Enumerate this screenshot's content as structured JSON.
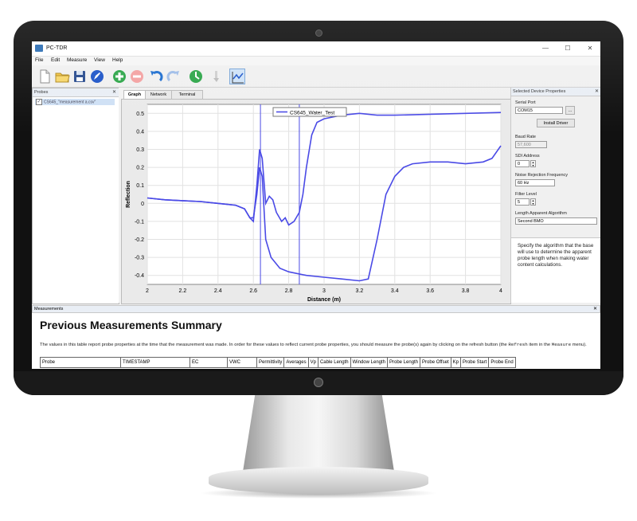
{
  "window": {
    "title": "PC-TDR",
    "minimize": "—",
    "maximize": "☐",
    "close": "✕"
  },
  "menu": [
    "File",
    "Edit",
    "Measure",
    "View",
    "Help"
  ],
  "toolbar_icons": [
    "new-file-icon",
    "open-folder-icon",
    "save-disk-icon",
    "edit-pen-icon",
    "add-icon",
    "remove-icon",
    "undo-icon",
    "redo-icon",
    "measure-icon",
    "pointer-icon",
    "graph-icon"
  ],
  "probes_panel": {
    "title": "Probes",
    "close": "✕",
    "items": [
      {
        "label": "CS645_\"measurement a.csv\"",
        "checked": "✓"
      }
    ]
  },
  "tabs": [
    "Graph",
    "Network",
    "Terminal"
  ],
  "chart_data": {
    "type": "line",
    "title": "",
    "xlabel": "Distance (m)",
    "ylabel": "Reflection",
    "xlim": [
      2,
      4
    ],
    "ylim": [
      -0.45,
      0.55
    ],
    "x_ticks": [
      "2",
      "2.2",
      "2.4",
      "2.6",
      "2.8",
      "3",
      "3.2",
      "3.4",
      "3.6",
      "3.8",
      "4"
    ],
    "y_ticks": [
      "0.5",
      "0.4",
      "0.3",
      "0.2",
      "0.1",
      "0",
      "-0.1",
      "-0.2",
      "-0.3",
      "-0.4"
    ],
    "grid": true,
    "legend": {
      "position": "top-center",
      "entries": [
        "CS645_Water_Test"
      ]
    },
    "vertical_markers": [
      2.64,
      2.86
    ],
    "line_color": "#4a4ae6",
    "series": [
      {
        "name": "CS645_Water_Test",
        "points": [
          [
            2.0,
            0.03
          ],
          [
            2.1,
            0.02
          ],
          [
            2.2,
            0.015
          ],
          [
            2.3,
            0.01
          ],
          [
            2.4,
            0.0
          ],
          [
            2.5,
            -0.01
          ],
          [
            2.55,
            -0.03
          ],
          [
            2.58,
            -0.08
          ],
          [
            2.6,
            -0.1
          ],
          [
            2.62,
            0.1
          ],
          [
            2.635,
            0.3
          ],
          [
            2.65,
            0.25
          ],
          [
            2.67,
            0.0
          ],
          [
            2.69,
            0.04
          ],
          [
            2.71,
            0.02
          ],
          [
            2.73,
            -0.05
          ],
          [
            2.76,
            -0.1
          ],
          [
            2.78,
            -0.08
          ],
          [
            2.8,
            -0.12
          ],
          [
            2.83,
            -0.1
          ],
          [
            2.86,
            -0.05
          ],
          [
            2.88,
            0.05
          ],
          [
            2.9,
            0.2
          ],
          [
            2.93,
            0.38
          ],
          [
            2.96,
            0.45
          ],
          [
            3.0,
            0.47
          ],
          [
            3.1,
            0.49
          ],
          [
            3.2,
            0.5
          ],
          [
            3.3,
            0.49
          ],
          [
            3.4,
            0.49
          ],
          [
            3.6,
            0.495
          ],
          [
            3.8,
            0.5
          ],
          [
            4.0,
            0.505
          ]
        ]
      },
      {
        "name": "",
        "points": [
          [
            2.0,
            0.03
          ],
          [
            2.1,
            0.02
          ],
          [
            2.2,
            0.015
          ],
          [
            2.3,
            0.01
          ],
          [
            2.4,
            0.0
          ],
          [
            2.5,
            -0.01
          ],
          [
            2.55,
            -0.03
          ],
          [
            2.58,
            -0.08
          ],
          [
            2.6,
            -0.08
          ],
          [
            2.62,
            0.05
          ],
          [
            2.635,
            0.2
          ],
          [
            2.65,
            0.15
          ],
          [
            2.67,
            -0.2
          ],
          [
            2.7,
            -0.3
          ],
          [
            2.75,
            -0.36
          ],
          [
            2.8,
            -0.38
          ],
          [
            2.9,
            -0.4
          ],
          [
            3.0,
            -0.41
          ],
          [
            3.1,
            -0.42
          ],
          [
            3.2,
            -0.43
          ],
          [
            3.25,
            -0.42
          ],
          [
            3.3,
            -0.2
          ],
          [
            3.35,
            0.05
          ],
          [
            3.4,
            0.15
          ],
          [
            3.45,
            0.2
          ],
          [
            3.5,
            0.22
          ],
          [
            3.6,
            0.23
          ],
          [
            3.7,
            0.23
          ],
          [
            3.8,
            0.22
          ],
          [
            3.9,
            0.23
          ],
          [
            3.95,
            0.25
          ],
          [
            4.0,
            0.32
          ]
        ]
      }
    ]
  },
  "properties": {
    "title": "Selected Device Properties",
    "close": "✕",
    "serial_port_label": "Serial Port",
    "serial_port_value": "COM15",
    "browse_label": "...",
    "install_driver": "Install Driver",
    "baud_rate_label": "Baud Rate",
    "baud_rate_value": "57,600",
    "sdi_label": "SDI Address",
    "sdi_value": "0",
    "noise_label": "Noise Rejection Frequency",
    "noise_value": "60 Hz",
    "filter_label": "Filter Level",
    "filter_value": "5",
    "algorithm_label": "Length Apparent Algorithm",
    "algorithm_value": "Second BMO",
    "description": "Specify the algorithm that the base will use to determine the apparent probe length when making water content calculations."
  },
  "measurements": {
    "panel_title": "Measurements",
    "close": "✕",
    "heading": "Previous Measurements Summary",
    "text_before": "The values in this table report probe properties at the time that the measurement was made. In order for these values to reflect current probe properties, you should measure the probe(s) again by clicking on the refresh button (the ",
    "refresh_word": "Refresh",
    "text_middle": " item in the ",
    "measure_word": "Measure",
    "text_after": " menu).",
    "columns": [
      "Probe",
      "TIMESTAMP",
      "EC",
      "VWC",
      "Permittivity",
      "Averages",
      "Vp",
      "Cable Length",
      "Window Length",
      "Probe Length",
      "Probe Offset",
      "Kp",
      "Probe Start",
      "Probe End"
    ]
  }
}
